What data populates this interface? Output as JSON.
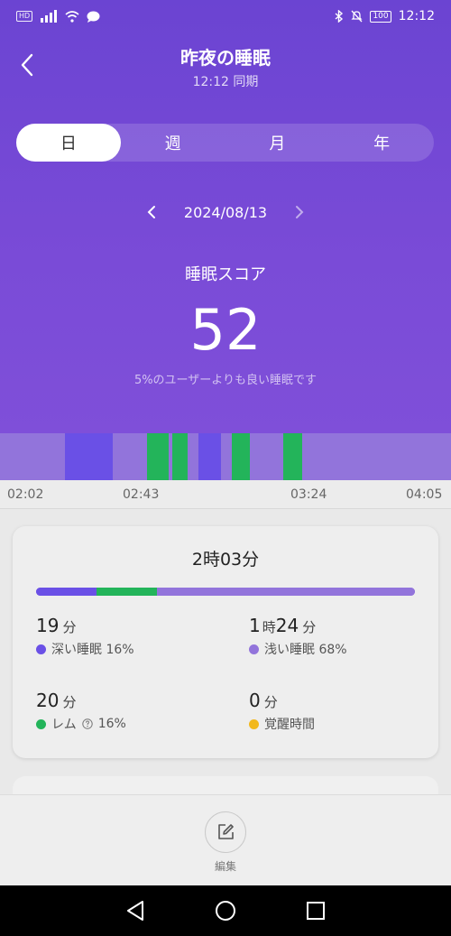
{
  "status_bar": {
    "time": "12:12",
    "hd": "HD",
    "battery": "100"
  },
  "header": {
    "title": "昨夜の睡眠",
    "subtitle": "12:12 同期"
  },
  "tabs": [
    {
      "label": "日",
      "active": true
    },
    {
      "label": "週",
      "active": false
    },
    {
      "label": "月",
      "active": false
    },
    {
      "label": "年",
      "active": false
    }
  ],
  "date_nav": {
    "date": "2024/08/13"
  },
  "score": {
    "label": "睡眠スコア",
    "value": "52",
    "description": "5%のユーザーよりも良い睡眠です"
  },
  "timeline": {
    "ticks": [
      "02:02",
      "02:43",
      "03:24",
      "04:05"
    ]
  },
  "summary": {
    "total": "2時03分",
    "distribution": {
      "deep": 16,
      "rem": 16,
      "light": 68
    },
    "stats": {
      "deep": {
        "value": "19",
        "unit": "分",
        "label": "深い睡眠 16%"
      },
      "light": {
        "value_h": "1",
        "unit_h": "時",
        "value_m": "24",
        "unit_m": "分",
        "label": "浅い睡眠 68%"
      },
      "rem": {
        "value": "20",
        "unit": "分",
        "label": "レム",
        "percent": "16%"
      },
      "awake": {
        "value": "0",
        "unit": "分",
        "label": "覚醒時間"
      }
    }
  },
  "bottom": {
    "edit_label": "編集"
  },
  "colors": {
    "deep": "#6a50e6",
    "light": "#9274db",
    "rem": "#23b45a",
    "awake": "#f2b81c",
    "header": "#7048d4"
  }
}
